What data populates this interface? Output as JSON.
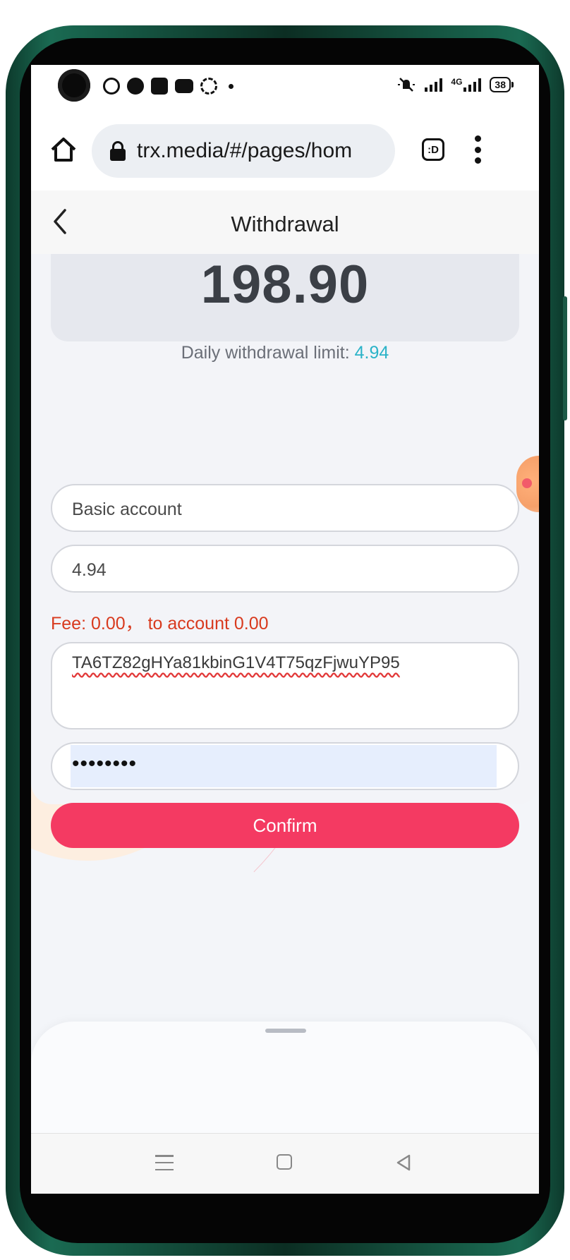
{
  "status_bar": {
    "network_label": "4G",
    "battery": "38"
  },
  "browser": {
    "url": "trx.media/#/pages/hom",
    "tab_switcher_label": ":D"
  },
  "header": {
    "title": "Withdrawal"
  },
  "balance": {
    "value": "198.90",
    "daily_limit_label": "Daily withdrawal limit:",
    "daily_limit_value": "4.94"
  },
  "form": {
    "account_type": "Basic account",
    "amount": "4.94",
    "fee_text": "Fee: 0.00， to account 0.00",
    "address": "TA6TZ82gHYa81kbinG1V4T75qzFjwuYP95",
    "password_mask": "••••••••",
    "confirm_label": "Confirm"
  },
  "colors": {
    "accent": "#f43a62",
    "limit_value": "#2bb3c8",
    "fee_text": "#d83a1e"
  },
  "icons": {
    "status_left": [
      "camera",
      "whatsapp-icon",
      "telegram-icon",
      "vpn-icon",
      "youtube-icon",
      "sync-icon"
    ],
    "browser": [
      "home-icon",
      "lock-icon",
      "tab-switcher-icon",
      "more-vert-icon"
    ],
    "nav": [
      "recents-icon",
      "home-square-icon",
      "back-triangle-icon"
    ]
  }
}
